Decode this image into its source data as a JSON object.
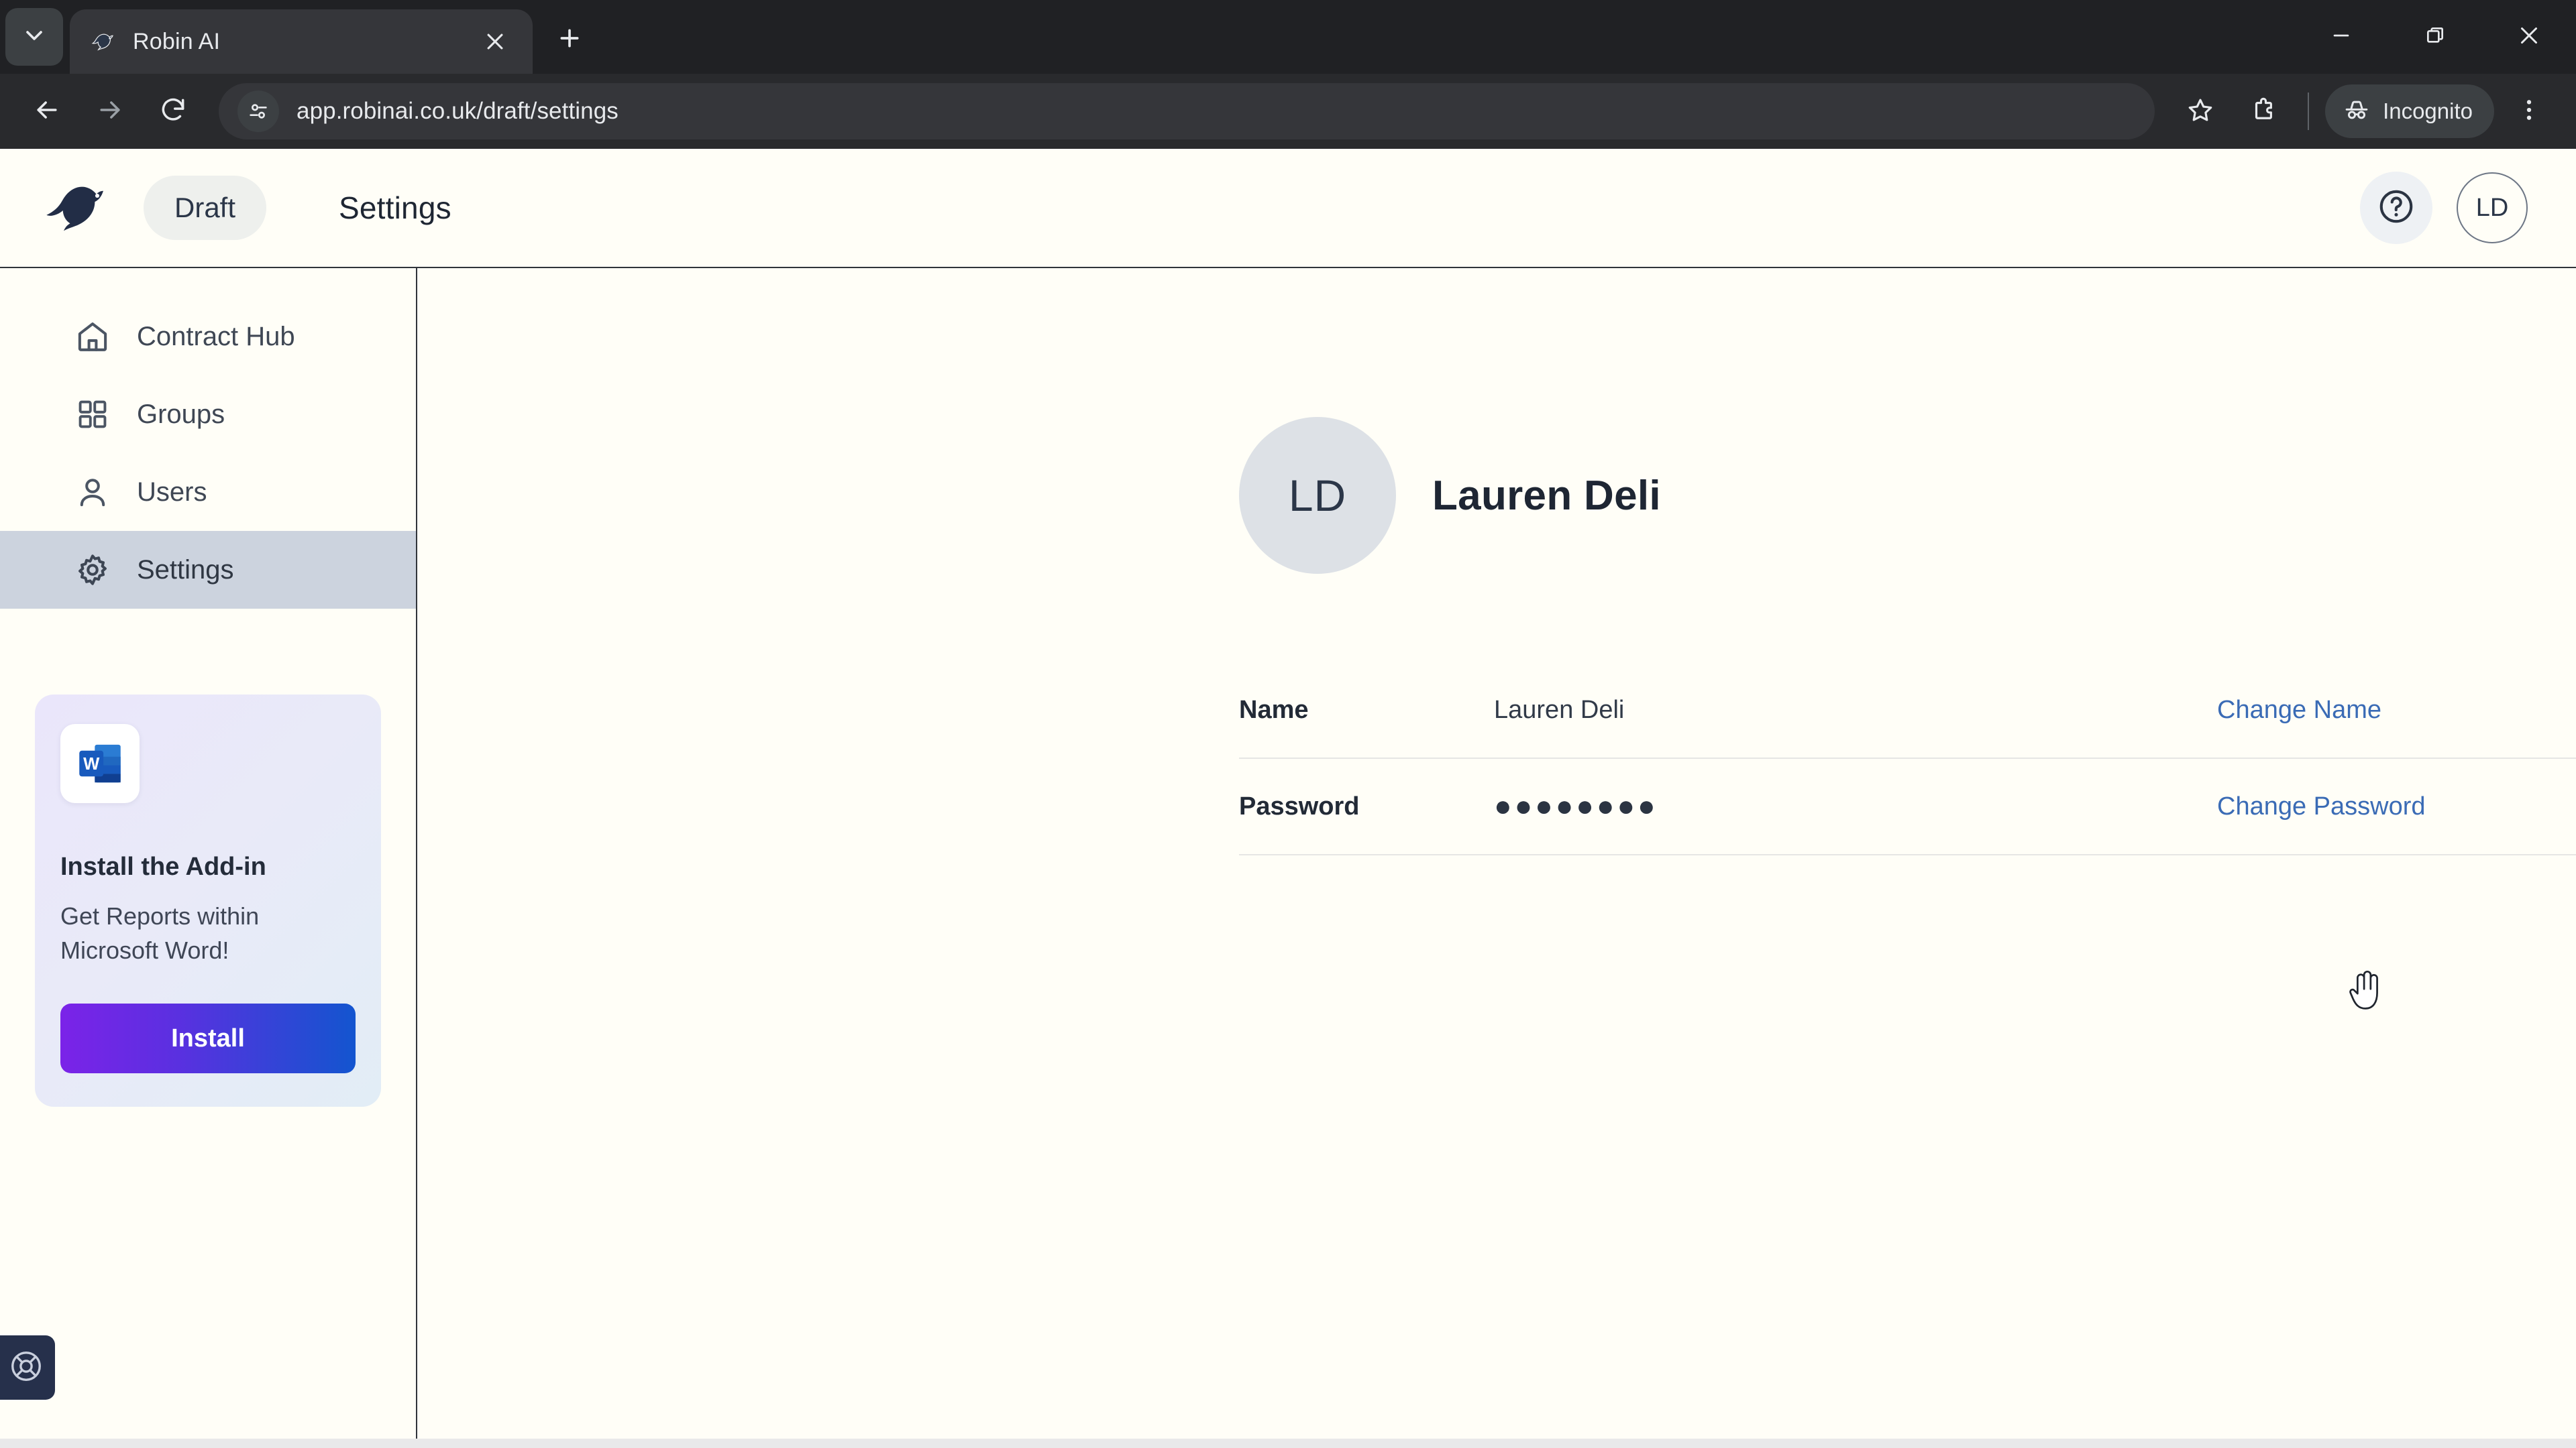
{
  "browser": {
    "tab": {
      "title": "Robin AI",
      "favicon_icon": "bird-favicon",
      "close_icon": "close-icon"
    },
    "tab_search_icon": "chevron-down-icon",
    "new_tab_icon": "plus-icon",
    "window_controls": {
      "minimize_icon": "minimize-icon",
      "restore_icon": "restore-icon",
      "close_icon": "close-icon"
    },
    "nav": {
      "back_icon": "back-arrow-icon",
      "forward_icon": "forward-arrow-icon",
      "reload_icon": "reload-icon"
    },
    "omnibox": {
      "site_settings_icon": "tune-sliders-icon",
      "url": "app.robinai.co.uk/draft/settings"
    },
    "bookmark_icon": "star-icon",
    "extensions_icon": "puzzle-piece-icon",
    "incognito": {
      "label": "Incognito",
      "icon": "incognito-hat-icon"
    },
    "menu_icon": "three-dots-menu-icon"
  },
  "app": {
    "logo_icon": "robin-bird-logo",
    "workspace": "Draft",
    "page_title": "Settings",
    "help_icon": "help-circle-icon",
    "avatar_initials": "LD"
  },
  "sidebar": {
    "items": [
      {
        "label": "Contract Hub",
        "icon": "home-icon",
        "active": false
      },
      {
        "label": "Groups",
        "icon": "grid-icon",
        "active": false
      },
      {
        "label": "Users",
        "icon": "user-icon",
        "active": false
      },
      {
        "label": "Settings",
        "icon": "gear-icon",
        "active": true
      }
    ],
    "promo": {
      "app_icon": "microsoft-word-icon",
      "title": "Install the Add-in",
      "subtitle": "Get Reports within Microsoft Word!",
      "button_label": "Install"
    },
    "support_icon": "lifebuoy-icon"
  },
  "profile": {
    "avatar_initials": "LD",
    "name": "Lauren Deli"
  },
  "settings_rows": [
    {
      "label": "Name",
      "value": "Lauren Deli",
      "action": "Change Name"
    },
    {
      "label": "Password",
      "value": "●●●●●●●●",
      "action": "Change Password"
    }
  ],
  "colors": {
    "page_bg": "#fffef7",
    "active_nav": "#ccd3de",
    "link": "#3a6bb5",
    "install_gradient_from": "#7b23e8",
    "install_gradient_to": "#1355cf",
    "support_bg": "#26304b"
  }
}
